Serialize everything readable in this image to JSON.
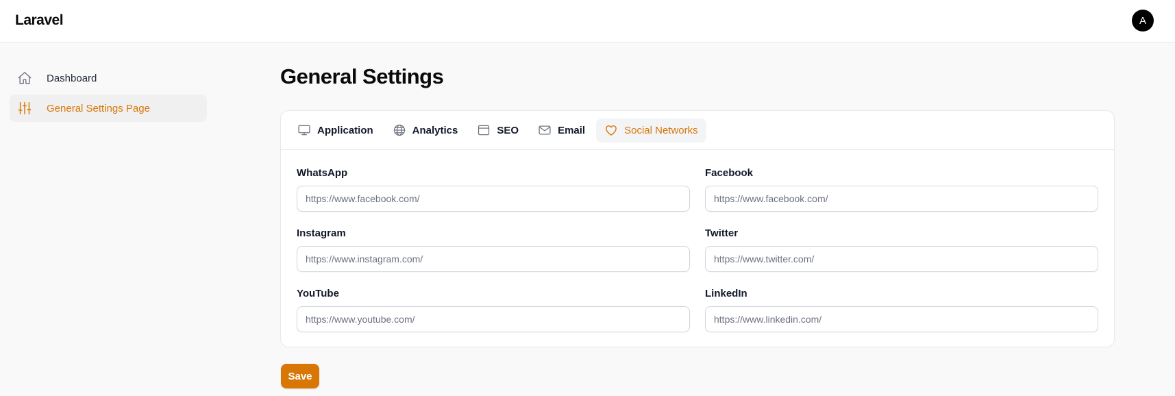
{
  "topbar": {
    "brand": "Laravel",
    "avatar_initial": "A"
  },
  "sidebar": {
    "items": [
      {
        "label": "Dashboard",
        "icon": "home-icon",
        "active": false
      },
      {
        "label": "General Settings Page",
        "icon": "sliders-icon",
        "active": true
      }
    ]
  },
  "page": {
    "title": "General Settings"
  },
  "tabs": [
    {
      "label": "Application",
      "icon": "monitor-icon",
      "active": false
    },
    {
      "label": "Analytics",
      "icon": "globe-icon",
      "active": false
    },
    {
      "label": "SEO",
      "icon": "window-icon",
      "active": false
    },
    {
      "label": "Email",
      "icon": "envelope-icon",
      "active": false
    },
    {
      "label": "Social Networks",
      "icon": "heart-icon",
      "active": true
    }
  ],
  "fields": [
    {
      "label": "WhatsApp",
      "placeholder": "https://www.facebook.com/",
      "value": ""
    },
    {
      "label": "Facebook",
      "placeholder": "https://www.facebook.com/",
      "value": ""
    },
    {
      "label": "Instagram",
      "placeholder": "https://www.instagram.com/",
      "value": ""
    },
    {
      "label": "Twitter",
      "placeholder": "https://www.twitter.com/",
      "value": ""
    },
    {
      "label": "YouTube",
      "placeholder": "https://www.youtube.com/",
      "value": ""
    },
    {
      "label": "LinkedIn",
      "placeholder": "https://www.linkedin.com/",
      "value": ""
    }
  ],
  "actions": {
    "save_label": "Save"
  },
  "colors": {
    "accent": "#d97706",
    "background": "#f9f9f9",
    "border": "#e5e7eb"
  }
}
